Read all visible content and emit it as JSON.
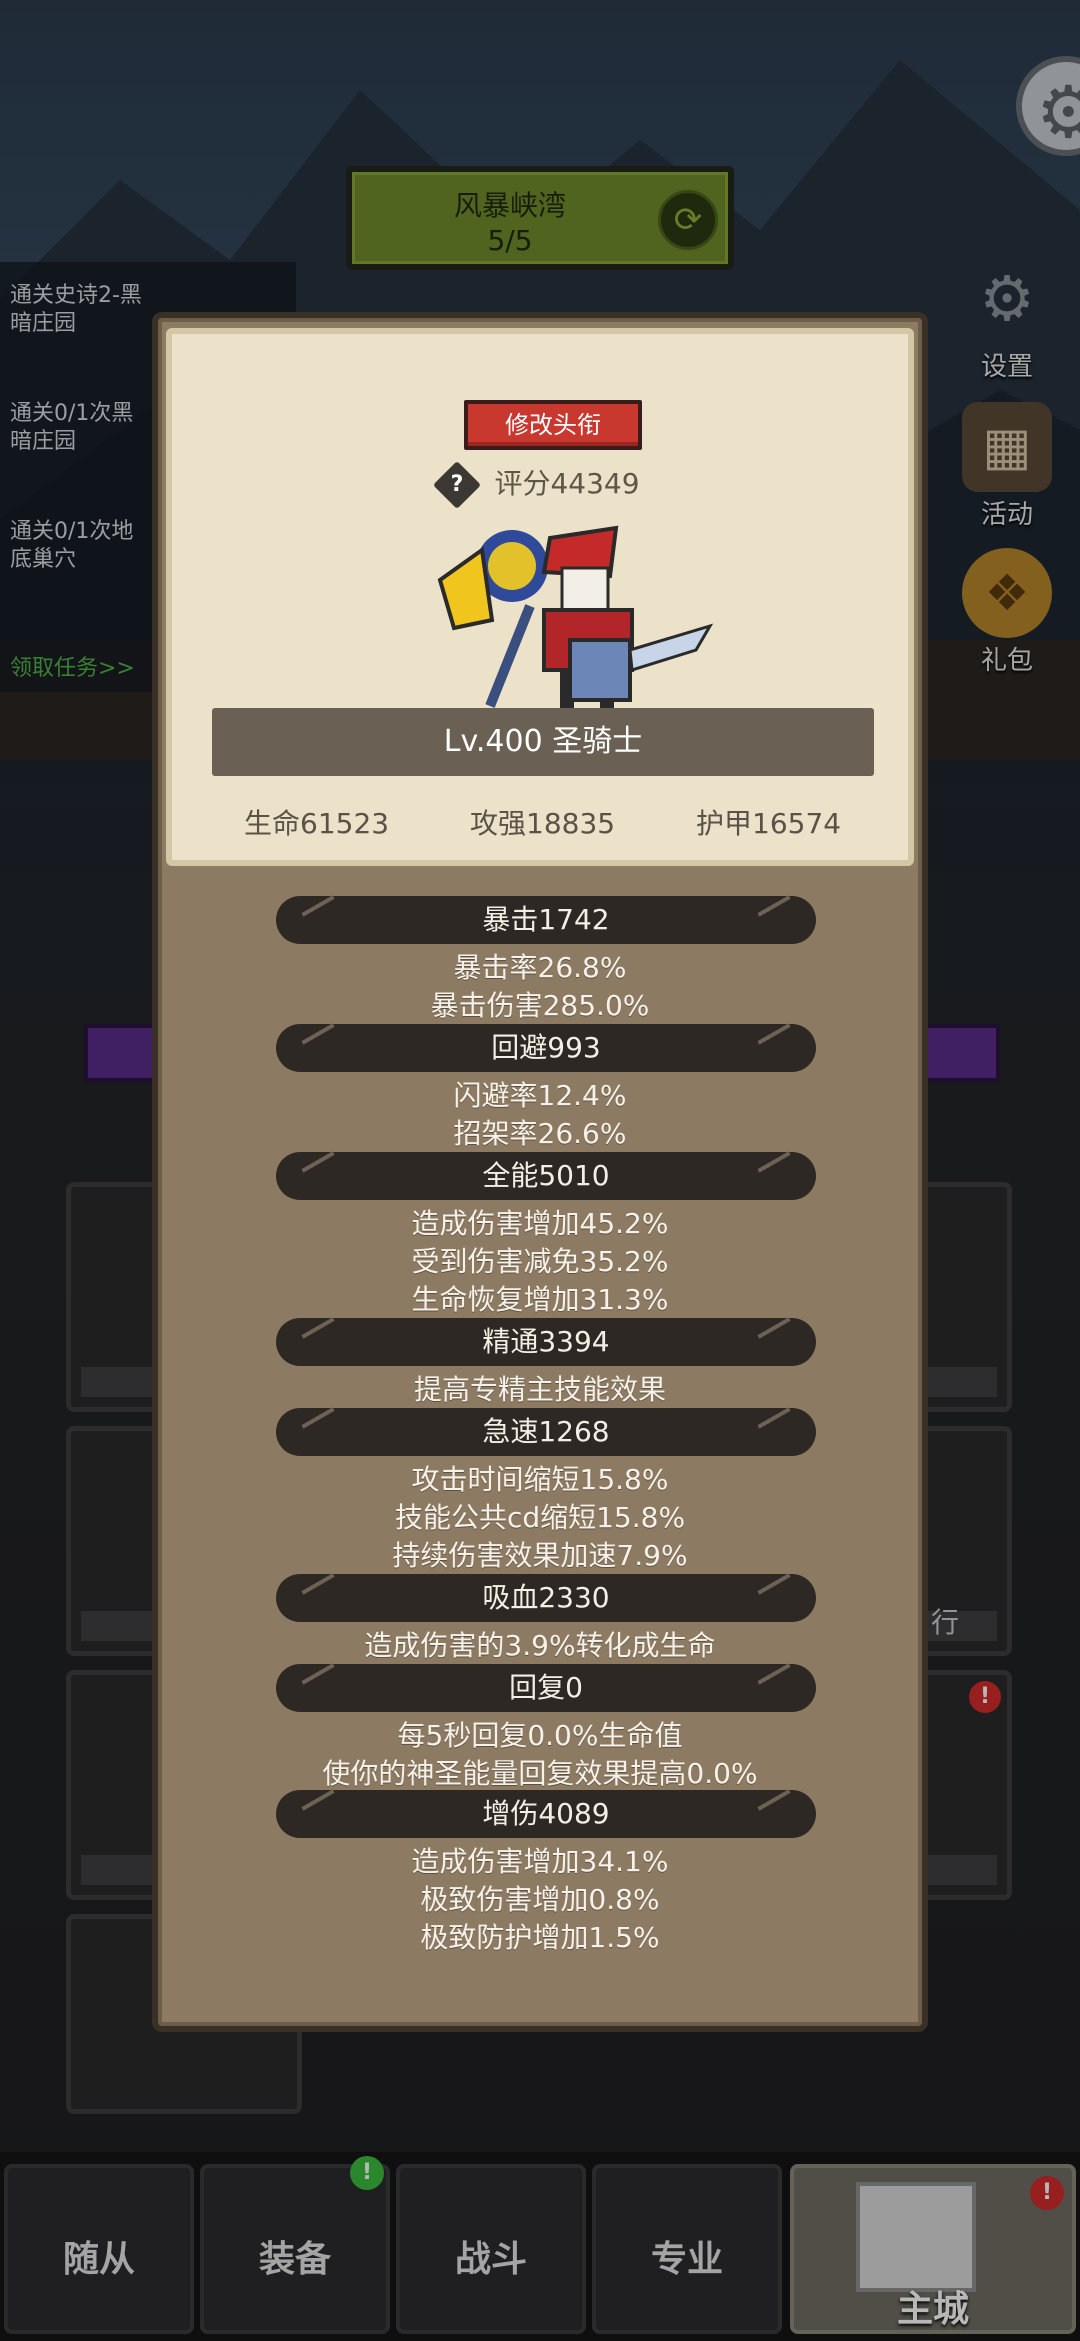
{
  "background": {
    "banner": {
      "title": "风暴峡湾",
      "progress": "5/5"
    },
    "side_buttons": [
      {
        "label": "设置",
        "icon": "gear-icon"
      },
      {
        "label": "活动",
        "icon": "calendar-icon"
      },
      {
        "label": "礼包",
        "icon": "gift-icon"
      }
    ],
    "quests": [
      {
        "line1": "通关史诗2-黑",
        "line2": "暗庄园"
      },
      {
        "line1": "通关0/1次黑",
        "line2": "暗庄园"
      },
      {
        "line1": "通关0/1次地",
        "line2": "底巢穴"
      }
    ],
    "quest_link": "领取任务>>",
    "right_slot_label": "行"
  },
  "nav": {
    "tabs": [
      "随从",
      "装备",
      "战斗",
      "专业",
      "主城"
    ],
    "badge_equipment": "!",
    "badge_main": "!"
  },
  "modal": {
    "title_button": "修改头衔",
    "help_icon": "?",
    "score": "评分44349",
    "level_class": "Lv.400 圣骑士",
    "main_stats": [
      "生命61523",
      "攻强18835",
      "护甲16574"
    ],
    "sections": [
      {
        "head": "暴击1742",
        "lines": [
          "暴击率26.8%",
          "暴击伤害285.0%"
        ]
      },
      {
        "head": "回避993",
        "lines": [
          "闪避率12.4%",
          "招架率26.6%"
        ]
      },
      {
        "head": "全能5010",
        "lines": [
          "造成伤害增加45.2%",
          "受到伤害减免35.2%",
          "生命恢复增加31.3%"
        ]
      },
      {
        "head": "精通3394",
        "lines": [
          "提高专精主技能效果"
        ]
      },
      {
        "head": "急速1268",
        "lines": [
          "攻击时间缩短15.8%",
          "技能公共cd缩短15.8%",
          "持续伤害效果加速7.9%"
        ]
      },
      {
        "head": "吸血2330",
        "lines": [
          "造成伤害的3.9%转化成生命"
        ]
      },
      {
        "head": "回复0",
        "lines": [
          "每5秒回复0.0%生命值",
          "使你的神圣能量回复效果提高0.0%"
        ]
      },
      {
        "head": "增伤4089",
        "lines": [
          "造成伤害增加34.1%",
          "极致伤害增加0.8%",
          "极致防护增加1.5%"
        ]
      }
    ]
  }
}
